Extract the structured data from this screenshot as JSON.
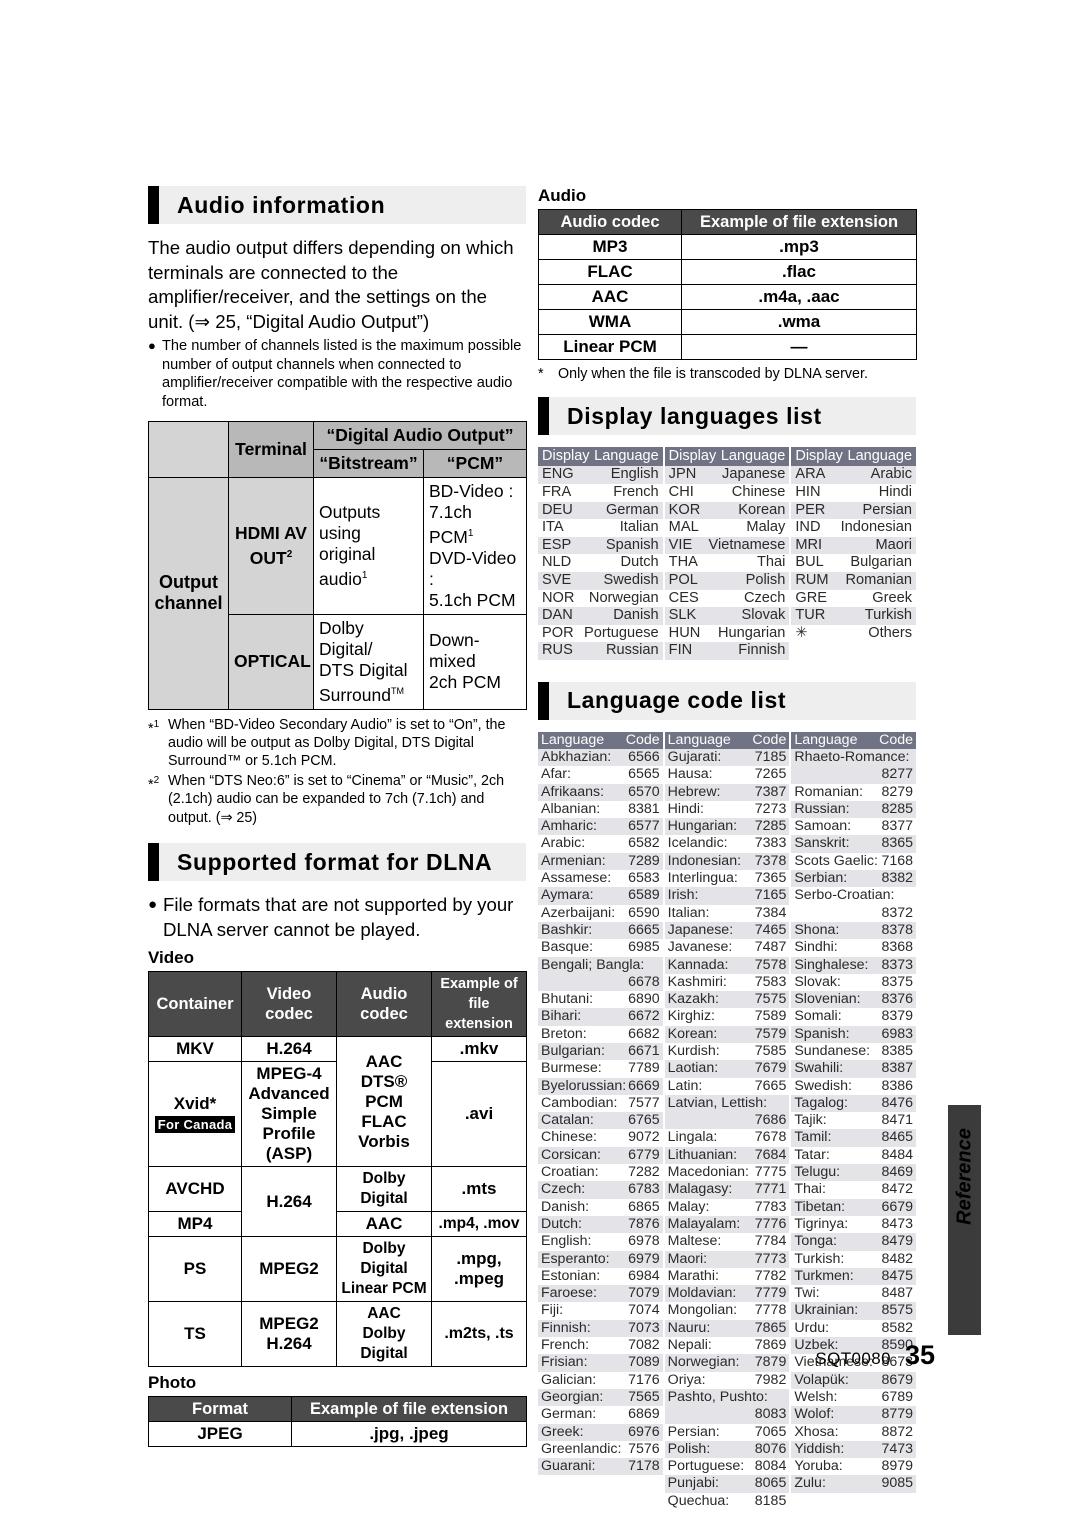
{
  "page": {
    "doc_code": "SQT0080",
    "page_number": "35",
    "side_tab_label": "Reference"
  },
  "audio_information": {
    "heading": "Audio information",
    "intro": "The audio output differs depending on which terminals are connected to the amplifier/receiver, and the settings on the unit. (⇒ 25, “Digital Audio Output”)",
    "bullet": "The number of channels listed is the maximum possible number of output channels when connected to amplifier/receiver compatible with the respective audio format.",
    "table": {
      "corner_blank": "",
      "terminal_header": "Terminal",
      "group_header": "“Digital Audio Output”",
      "bitstream_header": "“Bitstream”",
      "pcm_header": "“PCM”",
      "row_label": "Output channel",
      "rows": [
        {
          "terminal": "HDMI AV OUT",
          "terminal_fn": "2",
          "bitstream": "Outputs using original audio",
          "bitstream_fn": "1",
          "pcm_line1": "BD-Video :",
          "pcm_line2": "7.1ch PCM",
          "pcm_fn": "1",
          "pcm_line3": "DVD-Video :",
          "pcm_line4": "5.1ch PCM"
        },
        {
          "terminal": "OPTICAL",
          "terminal_fn": "",
          "bitstream_line1": "Dolby Digital/",
          "bitstream_line2": "DTS Digital",
          "bitstream_line3": "Surround",
          "bitstream_tm": "TM",
          "pcm_line1": "Down-mixed",
          "pcm_line2": "2ch PCM"
        }
      ]
    },
    "footnotes": [
      {
        "mark": "1",
        "text": "When “BD-Video Secondary Audio” is set to “On”, the audio will be output as Dolby Digital, DTS Digital Surround™ or 5.1ch PCM."
      },
      {
        "mark": "2",
        "text": "When “DTS Neo:6” is set to “Cinema” or “Music”, 2ch (2.1ch) audio can be expanded to 7ch (7.1ch) and output. (⇒ 25)"
      }
    ]
  },
  "dlna": {
    "heading": "Supported format for DLNA",
    "bullet": "File formats that are not supported by your DLNA server cannot be played.",
    "video_label": "Video",
    "video_table": {
      "headers": [
        "Container",
        "Video codec",
        "Audio codec",
        "Example of file extension"
      ],
      "rows": [
        {
          "container": "MKV",
          "container_badge": "",
          "video": "H.264",
          "audio": "",
          "ext": ".mkv"
        },
        {
          "container": "Xvid*",
          "container_badge": "For Canada",
          "video": "MPEG-4 Advanced Simple Profile (ASP)",
          "audio": "AAC\nDTS®\nPCM\nFLAC\nVorbis",
          "ext": ".avi"
        },
        {
          "container": "AVCHD",
          "container_badge": "",
          "video": "H.264",
          "audio": "Dolby Digital",
          "ext": ".mts"
        },
        {
          "container": "MP4",
          "container_badge": "",
          "video": "",
          "audio": "AAC",
          "ext": ".mp4, .mov"
        },
        {
          "container": "PS",
          "container_badge": "",
          "video": "MPEG2",
          "audio": "Dolby Digital\nLinear PCM",
          "ext": ".mpg, .mpeg"
        },
        {
          "container": "TS",
          "container_badge": "",
          "video": "MPEG2\nH.264",
          "audio": "AAC\nDolby Digital",
          "ext": ".m2ts, .ts"
        }
      ]
    },
    "photo_label": "Photo",
    "photo_table": {
      "headers": [
        "Format",
        "Example of file extension"
      ],
      "rows": [
        [
          "JPEG",
          ".jpg, .jpeg"
        ]
      ]
    },
    "audio_label": "Audio",
    "audio_table": {
      "headers": [
        "Audio codec",
        "Example of file extension"
      ],
      "rows": [
        [
          "MP3",
          ".mp3"
        ],
        [
          "FLAC",
          ".flac"
        ],
        [
          "AAC",
          ".m4a, .aac"
        ],
        [
          "WMA",
          ".wma"
        ],
        [
          "Linear PCM",
          "—"
        ]
      ]
    },
    "audio_footnote": {
      "mark": "*",
      "text": "Only when the file is transcoded by DLNA server."
    }
  },
  "display_languages": {
    "heading": "Display languages list",
    "header_display": "Display",
    "header_language": "Language",
    "columns": [
      [
        [
          "ENG",
          "English"
        ],
        [
          "FRA",
          "French"
        ],
        [
          "DEU",
          "German"
        ],
        [
          "ITA",
          "Italian"
        ],
        [
          "ESP",
          "Spanish"
        ],
        [
          "NLD",
          "Dutch"
        ],
        [
          "SVE",
          "Swedish"
        ],
        [
          "NOR",
          "Norwegian"
        ],
        [
          "DAN",
          "Danish"
        ],
        [
          "POR",
          "Portuguese"
        ],
        [
          "RUS",
          "Russian"
        ]
      ],
      [
        [
          "JPN",
          "Japanese"
        ],
        [
          "CHI",
          "Chinese"
        ],
        [
          "KOR",
          "Korean"
        ],
        [
          "MAL",
          "Malay"
        ],
        [
          "VIE",
          "Vietnamese"
        ],
        [
          "THA",
          "Thai"
        ],
        [
          "POL",
          "Polish"
        ],
        [
          "CES",
          "Czech"
        ],
        [
          "SLK",
          "Slovak"
        ],
        [
          "HUN",
          "Hungarian"
        ],
        [
          "FIN",
          "Finnish"
        ]
      ],
      [
        [
          "ARA",
          "Arabic"
        ],
        [
          "HIN",
          "Hindi"
        ],
        [
          "PER",
          "Persian"
        ],
        [
          "IND",
          "Indonesian"
        ],
        [
          "MRI",
          "Maori"
        ],
        [
          "BUL",
          "Bulgarian"
        ],
        [
          "RUM",
          "Romanian"
        ],
        [
          "GRE",
          "Greek"
        ],
        [
          "TUR",
          "Turkish"
        ],
        [
          "✳",
          "Others"
        ]
      ]
    ]
  },
  "language_codes": {
    "heading": "Language code list",
    "header_language": "Language",
    "header_code": "Code",
    "columns": [
      [
        [
          "Abkhazian:",
          "6566"
        ],
        [
          "Afar:",
          "6565"
        ],
        [
          "Afrikaans:",
          "6570"
        ],
        [
          "Albanian:",
          "8381"
        ],
        [
          "Amharic:",
          "6577"
        ],
        [
          "Arabic:",
          "6582"
        ],
        [
          "Armenian:",
          "7289"
        ],
        [
          "Assamese:",
          "6583"
        ],
        [
          "Aymara:",
          "6589"
        ],
        [
          "Azerbaijani:",
          "6590"
        ],
        [
          "Bashkir:",
          "6665"
        ],
        [
          "Basque:",
          "6985"
        ],
        [
          "Bengali; Bangla:",
          "6678"
        ],
        [
          "Bhutani:",
          "6890"
        ],
        [
          "Bihari:",
          "6672"
        ],
        [
          "Breton:",
          "6682"
        ],
        [
          "Bulgarian:",
          "6671"
        ],
        [
          "Burmese:",
          "7789"
        ],
        [
          "Byelorussian:",
          "6669"
        ],
        [
          "Cambodian:",
          "7577"
        ],
        [
          "Catalan:",
          "6765"
        ],
        [
          "Chinese:",
          "9072"
        ],
        [
          "Corsican:",
          "6779"
        ],
        [
          "Croatian:",
          "7282"
        ],
        [
          "Czech:",
          "6783"
        ],
        [
          "Danish:",
          "6865"
        ],
        [
          "Dutch:",
          "7876"
        ],
        [
          "English:",
          "6978"
        ],
        [
          "Esperanto:",
          "6979"
        ],
        [
          "Estonian:",
          "6984"
        ],
        [
          "Faroese:",
          "7079"
        ],
        [
          "Fiji:",
          "7074"
        ],
        [
          "Finnish:",
          "7073"
        ],
        [
          "French:",
          "7082"
        ],
        [
          "Frisian:",
          "7089"
        ],
        [
          "Galician:",
          "7176"
        ],
        [
          "Georgian:",
          "7565"
        ],
        [
          "German:",
          "6869"
        ],
        [
          "Greek:",
          "6976"
        ],
        [
          "Greenlandic:",
          "7576"
        ],
        [
          "Guarani:",
          "7178"
        ]
      ],
      [
        [
          "Gujarati:",
          "7185"
        ],
        [
          "Hausa:",
          "7265"
        ],
        [
          "Hebrew:",
          "7387"
        ],
        [
          "Hindi:",
          "7273"
        ],
        [
          "Hungarian:",
          "7285"
        ],
        [
          "Icelandic:",
          "7383"
        ],
        [
          "Indonesian:",
          "7378"
        ],
        [
          "Interlingua:",
          "7365"
        ],
        [
          "Irish:",
          "7165"
        ],
        [
          "Italian:",
          "7384"
        ],
        [
          "Japanese:",
          "7465"
        ],
        [
          "Javanese:",
          "7487"
        ],
        [
          "Kannada:",
          "7578"
        ],
        [
          "Kashmiri:",
          "7583"
        ],
        [
          "Kazakh:",
          "7575"
        ],
        [
          "Kirghiz:",
          "7589"
        ],
        [
          "Korean:",
          "7579"
        ],
        [
          "Kurdish:",
          "7585"
        ],
        [
          "Laotian:",
          "7679"
        ],
        [
          "Latin:",
          "7665"
        ],
        [
          "Latvian, Lettish:",
          "7686"
        ],
        [
          "Lingala:",
          "7678"
        ],
        [
          "Lithuanian:",
          "7684"
        ],
        [
          "Macedonian:",
          "7775"
        ],
        [
          "Malagasy:",
          "7771"
        ],
        [
          "Malay:",
          "7783"
        ],
        [
          "Malayalam:",
          "7776"
        ],
        [
          "Maltese:",
          "7784"
        ],
        [
          "Maori:",
          "7773"
        ],
        [
          "Marathi:",
          "7782"
        ],
        [
          "Moldavian:",
          "7779"
        ],
        [
          "Mongolian:",
          "7778"
        ],
        [
          "Nauru:",
          "7865"
        ],
        [
          "Nepali:",
          "7869"
        ],
        [
          "Norwegian:",
          "7879"
        ],
        [
          "Oriya:",
          "7982"
        ],
        [
          "Pashto, Pushto:",
          "8083"
        ],
        [
          "Persian:",
          "7065"
        ],
        [
          "Polish:",
          "8076"
        ],
        [
          "Portuguese:",
          "8084"
        ],
        [
          "Punjabi:",
          "8065"
        ],
        [
          "Quechua:",
          "8185"
        ]
      ],
      [
        [
          "Rhaeto-Romance:",
          "8277"
        ],
        [
          "Romanian:",
          "8279"
        ],
        [
          "Russian:",
          "8285"
        ],
        [
          "Samoan:",
          "8377"
        ],
        [
          "Sanskrit:",
          "8365"
        ],
        [
          "Scots Gaelic:",
          "7168"
        ],
        [
          "Serbian:",
          "8382"
        ],
        [
          "Serbo-Croatian:",
          "8372"
        ],
        [
          "Shona:",
          "8378"
        ],
        [
          "Sindhi:",
          "8368"
        ],
        [
          "Singhalese:",
          "8373"
        ],
        [
          "Slovak:",
          "8375"
        ],
        [
          "Slovenian:",
          "8376"
        ],
        [
          "Somali:",
          "8379"
        ],
        [
          "Spanish:",
          "6983"
        ],
        [
          "Sundanese:",
          "8385"
        ],
        [
          "Swahili:",
          "8387"
        ],
        [
          "Swedish:",
          "8386"
        ],
        [
          "Tagalog:",
          "8476"
        ],
        [
          "Tajik:",
          "8471"
        ],
        [
          "Tamil:",
          "8465"
        ],
        [
          "Tatar:",
          "8484"
        ],
        [
          "Telugu:",
          "8469"
        ],
        [
          "Thai:",
          "8472"
        ],
        [
          "Tibetan:",
          "6679"
        ],
        [
          "Tigrinya:",
          "8473"
        ],
        [
          "Tonga:",
          "8479"
        ],
        [
          "Turkish:",
          "8482"
        ],
        [
          "Turkmen:",
          "8475"
        ],
        [
          "Twi:",
          "8487"
        ],
        [
          "Ukrainian:",
          "8575"
        ],
        [
          "Urdu:",
          "8582"
        ],
        [
          "Uzbek:",
          "8590"
        ],
        [
          "Vietnamese:",
          "8673"
        ],
        [
          "Volapük:",
          "8679"
        ],
        [
          "Welsh:",
          "6789"
        ],
        [
          "Wolof:",
          "8779"
        ],
        [
          "Xhosa:",
          "8872"
        ],
        [
          "Yiddish:",
          "7473"
        ],
        [
          "Yoruba:",
          "8979"
        ],
        [
          "Zulu:",
          "9085"
        ]
      ]
    ]
  }
}
